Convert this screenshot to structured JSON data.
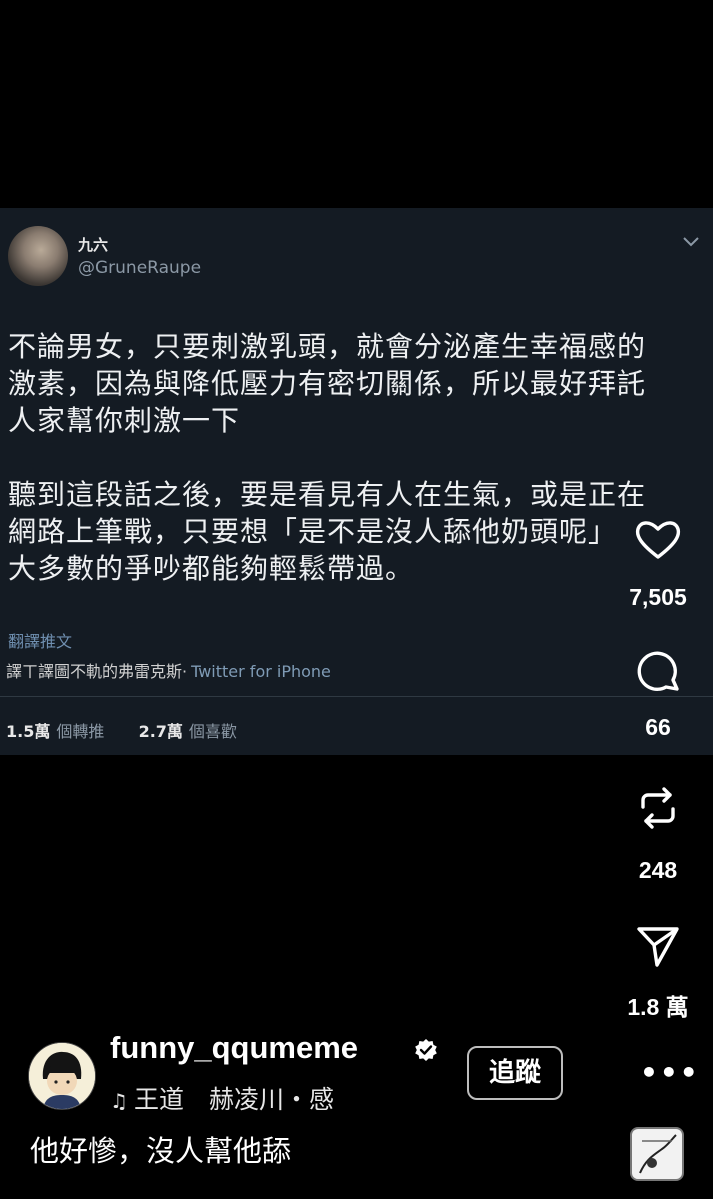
{
  "tweet": {
    "name": "九六",
    "handle": "@GruneRaupe",
    "body": "不論男女，只要刺激乳頭，就會分泌產生幸福感的\n激素，因為與降低壓力有密切關係，所以最好拜託\n人家幫你刺激一下\n\n聽到這段話之後，要是看見有人在生氣，或是正在\n網路上筆戰，只要想「是不是沒人舔他奶頭呢」\n大多數的爭吵都能夠輕鬆帶過。",
    "translate_label": "翻譯推文",
    "meta_text": "譯ㄒ譯圖不軌的弗雷克斯·",
    "source": "Twitter for iPhone",
    "retweets_value": "1.5萬",
    "retweets_label": "個轉推",
    "likes_value": "2.7萬",
    "likes_label": "個喜歡"
  },
  "rail": {
    "likes": "7,505",
    "comments": "66",
    "reposts": "248",
    "shares": "1.8 萬"
  },
  "post": {
    "username": "funny_qqumeme",
    "music": "王道　赫凌川・感",
    "follow_label": "追蹤",
    "more_label": "•••",
    "caption": "他好慘，沒人幫他舔"
  }
}
